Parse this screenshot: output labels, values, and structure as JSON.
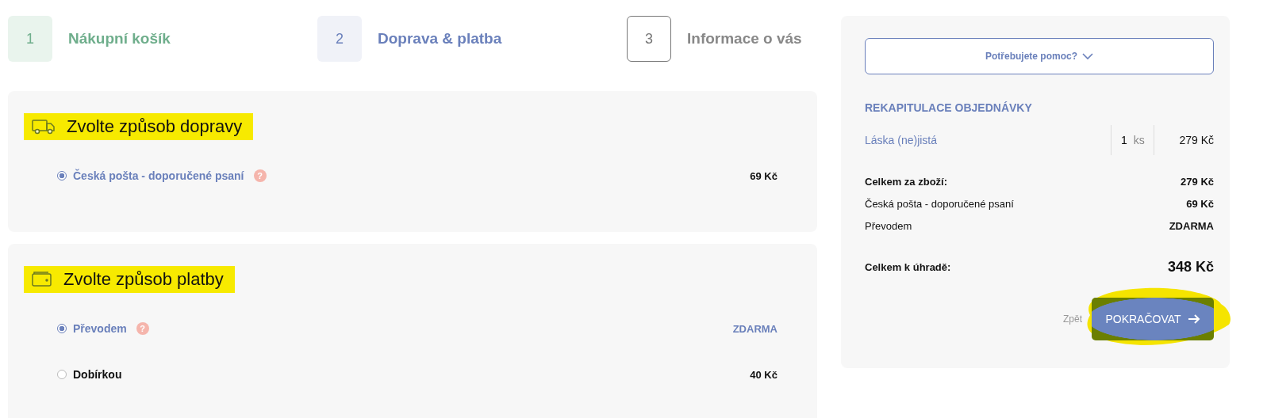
{
  "steps": [
    {
      "number": "1",
      "label": "Nákupní košík",
      "kind": "done"
    },
    {
      "number": "2",
      "label": "Doprava & platba",
      "kind": "current"
    },
    {
      "number": "3",
      "label": "Informace o vás",
      "kind": "upcoming"
    }
  ],
  "shipping": {
    "title": "Zvolte způsob dopravy",
    "highlighted": true,
    "options": [
      {
        "label": "Česká pošta - doporučené psaní",
        "help": "?",
        "price": "69 Kč",
        "price_accent": false,
        "selected": true
      }
    ]
  },
  "payment": {
    "title": "Zvolte způsob platby",
    "highlighted": true,
    "options": [
      {
        "label": "Převodem",
        "help": "?",
        "price": "ZDARMA",
        "price_accent": true,
        "selected": true
      },
      {
        "label": "Dobírkou",
        "price": "40 Kč",
        "price_accent": false,
        "selected": false
      }
    ]
  },
  "summary": {
    "help_button": "Potřebujete pomoc?",
    "title": "REKAPITULACE OBJEDNÁVKY",
    "items": [
      {
        "name": "Láska (ne)jistá",
        "qty": "1",
        "unit": "ks",
        "price": "279 Kč"
      }
    ],
    "lines": [
      {
        "label": "Celkem za zboží:",
        "value": "279 Kč",
        "bold": true
      },
      {
        "label": "Česká pošta - doporučené psaní",
        "value": "69 Kč",
        "bold": false
      },
      {
        "label": "Převodem",
        "value": "ZDARMA",
        "bold": false
      }
    ],
    "total": {
      "label": "Celkem k úhradě:",
      "value": "348 Kč"
    },
    "back": "Zpět",
    "continue": "POKRAČOVAT",
    "continue_highlighted": true
  }
}
